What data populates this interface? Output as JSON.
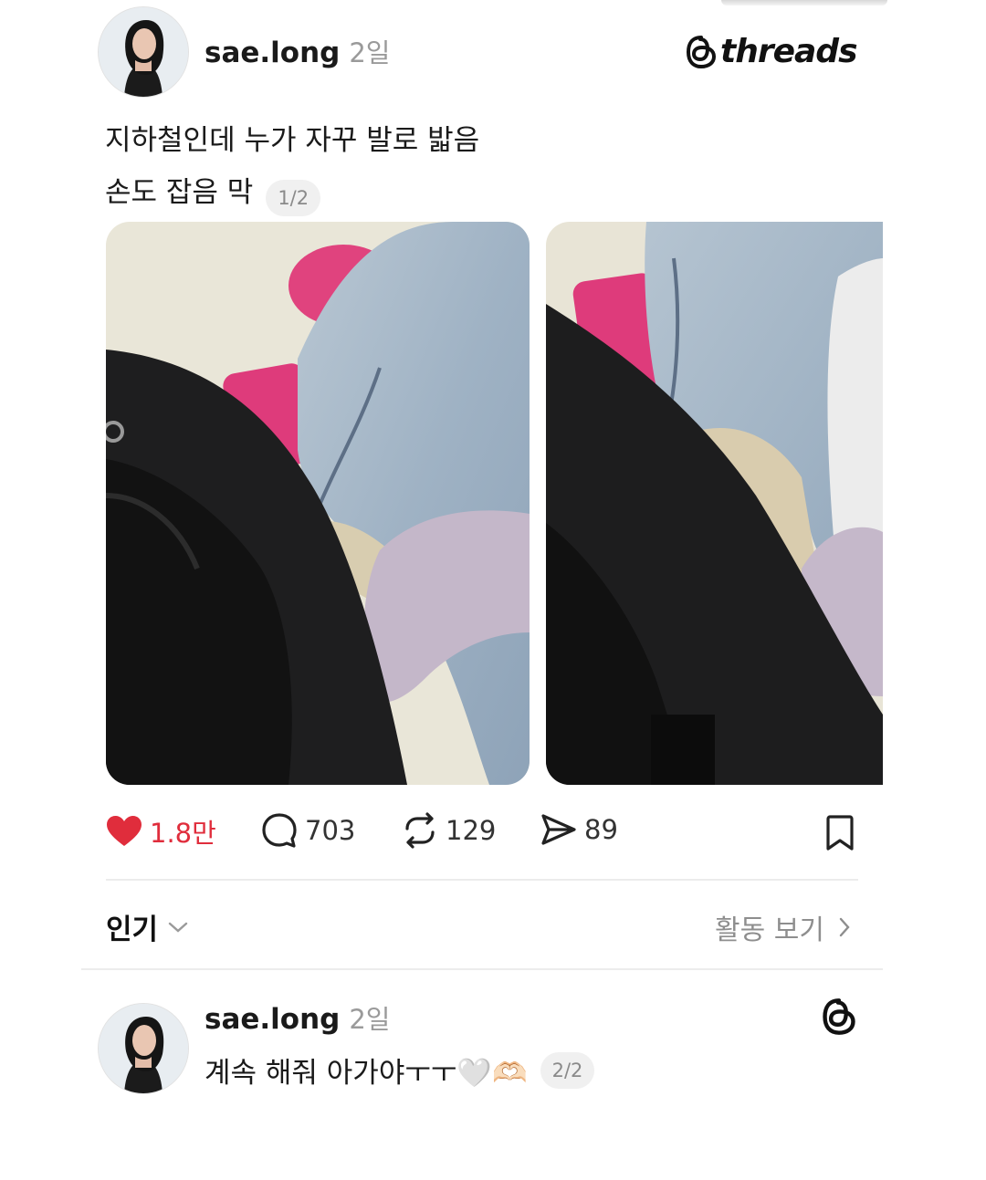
{
  "post": {
    "username": "sae.long",
    "time": "2일",
    "text_line1": "지하철인데 누가 자꾸 발로 밟음",
    "text_line2": "손도 잡음 막",
    "page_indicator": "1/2",
    "brand": "threads"
  },
  "actions": {
    "likes": "1.8만",
    "comments": "703",
    "reposts": "129",
    "shares": "89"
  },
  "sort": {
    "label": "인기",
    "activity_label": "활동 보기"
  },
  "reply": {
    "username": "sae.long",
    "time": "2일",
    "text": "계속 해줘 아가야ㅜㅜ🤍🫶🏻",
    "page_indicator": "2/2"
  },
  "colors": {
    "heart": "#e02d3c",
    "divider": "#ececec"
  }
}
